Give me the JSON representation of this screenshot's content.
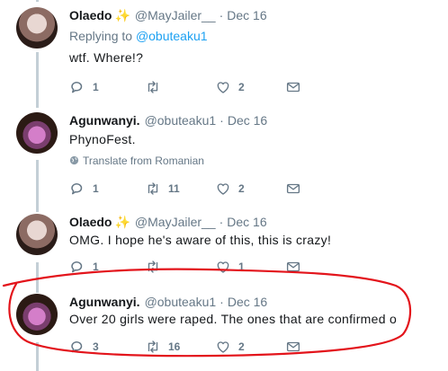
{
  "tweets": [
    {
      "name": "Olaedo",
      "handle": "@MayJailer__",
      "dot": "·",
      "date": "Dec 16",
      "reply_prefix": "Replying to",
      "reply_handle": "@obuteaku1",
      "text": "wtf. Where!?",
      "replies": "1",
      "retweets": "",
      "likes": "2"
    },
    {
      "name": "Agunwanyi.",
      "handle": "@obuteaku1",
      "dot": "·",
      "date": "Dec 16",
      "text": "PhynoFest.",
      "translate": "Translate from Romanian",
      "replies": "1",
      "retweets": "11",
      "likes": "2"
    },
    {
      "name": "Olaedo",
      "handle": "@MayJailer__",
      "dot": "·",
      "date": "Dec 16",
      "text": "OMG. I hope he's aware of this, this is crazy!",
      "replies": "1",
      "retweets": "",
      "likes": "1"
    },
    {
      "name": "Agunwanyi.",
      "handle": "@obuteaku1",
      "dot": "·",
      "date": "Dec 16",
      "text": "Over 20 girls were raped. The ones that are confirmed o",
      "replies": "3",
      "retweets": "16",
      "likes": "2"
    }
  ],
  "colors": {
    "name": "#14171a",
    "muted": "#657786",
    "link": "#1da1f2",
    "sparkle": "#f5b22d",
    "thread_line": "#c4cfd6",
    "annotation": "#e3141b"
  },
  "icons": [
    "reply-icon",
    "retweet-icon",
    "like-icon",
    "dm-icon",
    "sparkle-icon",
    "globe-icon"
  ]
}
